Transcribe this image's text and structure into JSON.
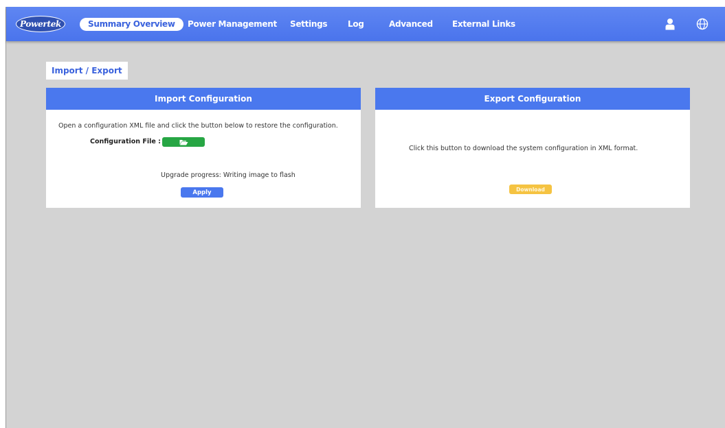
{
  "header": {
    "logo_text": "Powertek",
    "nav": [
      {
        "label": "Summary Overview",
        "active": true
      },
      {
        "label": "Power Management",
        "active": false
      },
      {
        "label": "Settings",
        "active": false
      },
      {
        "label": "Log",
        "active": false
      },
      {
        "label": "Advanced",
        "active": false
      },
      {
        "label": "External Links",
        "active": false
      }
    ],
    "icons": [
      "user-icon",
      "globe-icon"
    ]
  },
  "breadcrumb": "Import / Export",
  "import_panel": {
    "title": "Import Configuration",
    "description": "Open a configuration XML file and click the button below to restore the configuration.",
    "file_label": "Configuration File :",
    "file_button_icon": "folder-open-icon",
    "progress_text": "Upgrade progress: Writing image to flash",
    "apply_label": "Apply"
  },
  "export_panel": {
    "title": "Export Configuration",
    "description": "Click this button to download the system configuration in XML format.",
    "download_label": "Download"
  },
  "colors": {
    "nav_bar": "#4a74ec",
    "panel_header": "#4a78ee",
    "background": "#d3d3d3",
    "file_button": "#27a644",
    "apply_button": "#4a78ee",
    "download_button": "#f5c342"
  }
}
